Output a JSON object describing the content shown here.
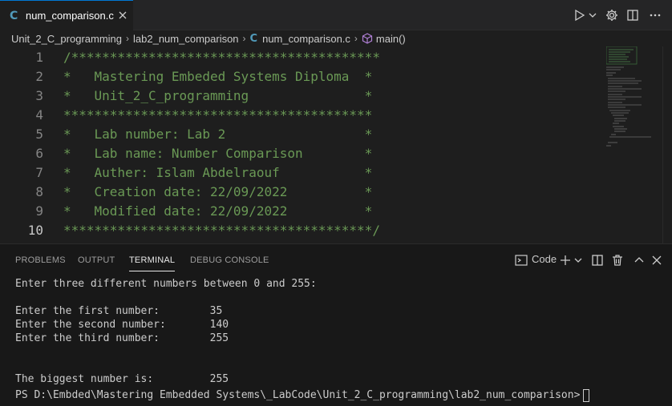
{
  "tab": {
    "language_icon": "C",
    "filename": "num_comparison.c"
  },
  "breadcrumb": {
    "folder1": "Unit_2_C_programming",
    "folder2": "lab2_num_comparison",
    "file_icon": "C",
    "file": "num_comparison.c",
    "symbol": "main()"
  },
  "editor": {
    "line_numbers": [
      "1",
      "2",
      "3",
      "4",
      "5",
      "6",
      "7",
      "8",
      "9",
      "10"
    ],
    "lines": [
      "/****************************************",
      "*   Mastering Embeded Systems Diploma  *",
      "*   Unit_2_C_programming               *",
      "****************************************",
      "*   Lab number: Lab 2                  *",
      "*   Lab name: Number Comparison        *",
      "*   Auther: Islam Abdelraouf           *",
      "*   Creation date: 22/09/2022          *",
      "*   Modified date: 22/09/2022          *",
      "****************************************/"
    ],
    "comment_color": "#6a9955"
  },
  "panel": {
    "tabs": [
      "PROBLEMS",
      "OUTPUT",
      "TERMINAL",
      "DEBUG CONSOLE"
    ],
    "active_tab": "TERMINAL",
    "terminal_shell_label": "Code"
  },
  "terminal": {
    "lines": [
      "Enter three different numbers between 0 and 255:",
      "",
      "Enter the first number:        35",
      "Enter the second number:       140",
      "Enter the third number:        255",
      "",
      "",
      "The biggest number is:         255",
      "PS D:\\Embded\\Mastering Embedded Systems\\_LabCode\\Unit_2_C_programming\\lab2_num_comparison>"
    ]
  },
  "icons": {
    "run": "play-icon",
    "settings": "gear-icon",
    "split": "split-editor-icon",
    "more": "ellipsis-icon",
    "terminal": "terminal-icon",
    "add": "plus-icon",
    "trash": "trash-icon"
  }
}
